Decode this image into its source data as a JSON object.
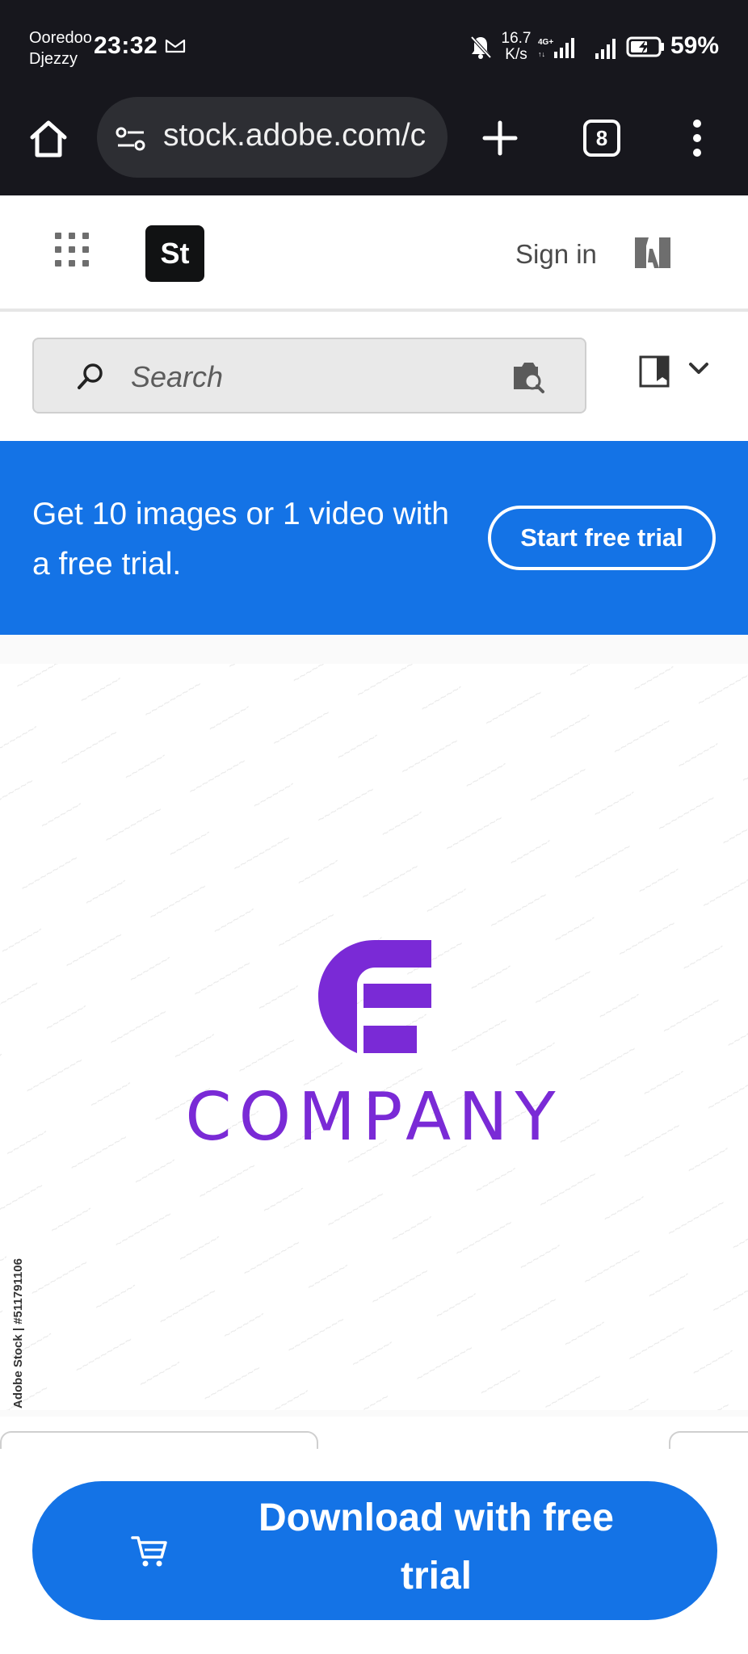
{
  "status_bar": {
    "carrier_1": "Ooredoo",
    "carrier_2": "Djezzy",
    "time": "23:32",
    "net_speed_value": "16.7",
    "net_speed_unit": "K/s",
    "network_type": "4G+",
    "battery_percent": "59%"
  },
  "browser": {
    "url": "stock.adobe.com/c",
    "tab_count": "8"
  },
  "header": {
    "logo_text": "St",
    "sign_in": "Sign in"
  },
  "search": {
    "placeholder": "Search"
  },
  "promo": {
    "text": "Get 10 images or 1 video with a free trial.",
    "button": "Start free trial"
  },
  "preview": {
    "logo_word": "COMPANY",
    "credit": "Adobe Stock | #511791106",
    "brand_color": "#7a2ad6"
  },
  "download": {
    "label": "Download with free trial"
  },
  "colors": {
    "accent": "#1473e6",
    "system_bar": "#17171d"
  }
}
